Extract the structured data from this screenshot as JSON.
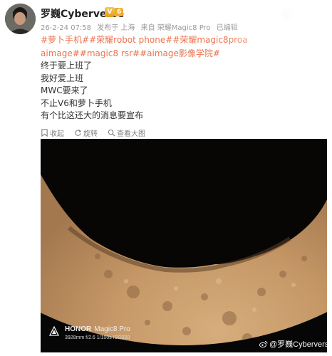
{
  "colors": {
    "link": "#eb7350",
    "meta": "#999999",
    "text": "#333333",
    "vip": "#f2ac2c"
  },
  "author": {
    "name": "罗巍Cyberverse",
    "vip_level": "6"
  },
  "meta": {
    "time": "26-2-24 07:58",
    "posted_from": "发布于 上海",
    "source": "来自 荣耀Magic8 Pro",
    "edited": "已编辑"
  },
  "tags": [
    "#萝卜手机#",
    "#荣耀robot phone#",
    "#荣耀magic8proa",
    "aimage#",
    "#magic8 rsr#",
    "#aimage影像学院#"
  ],
  "body": [
    "终于要上班了",
    "我好爱上班",
    "MWC要来了",
    "不止V6和萝卜手机",
    "有个比这还大的消息要宣布"
  ],
  "actions": [
    {
      "icon": "favorite-icon",
      "label": "收起"
    },
    {
      "icon": "rotate-icon",
      "label": "旋转"
    },
    {
      "icon": "zoom-icon",
      "label": "查看大图"
    }
  ],
  "photo": {
    "brand": "HONOR",
    "model": "Magic8 Pro",
    "camera_spec": "3928mm  f/2.6  1/100s  ISO320",
    "watermark": "@罗巍Cyberverse"
  }
}
